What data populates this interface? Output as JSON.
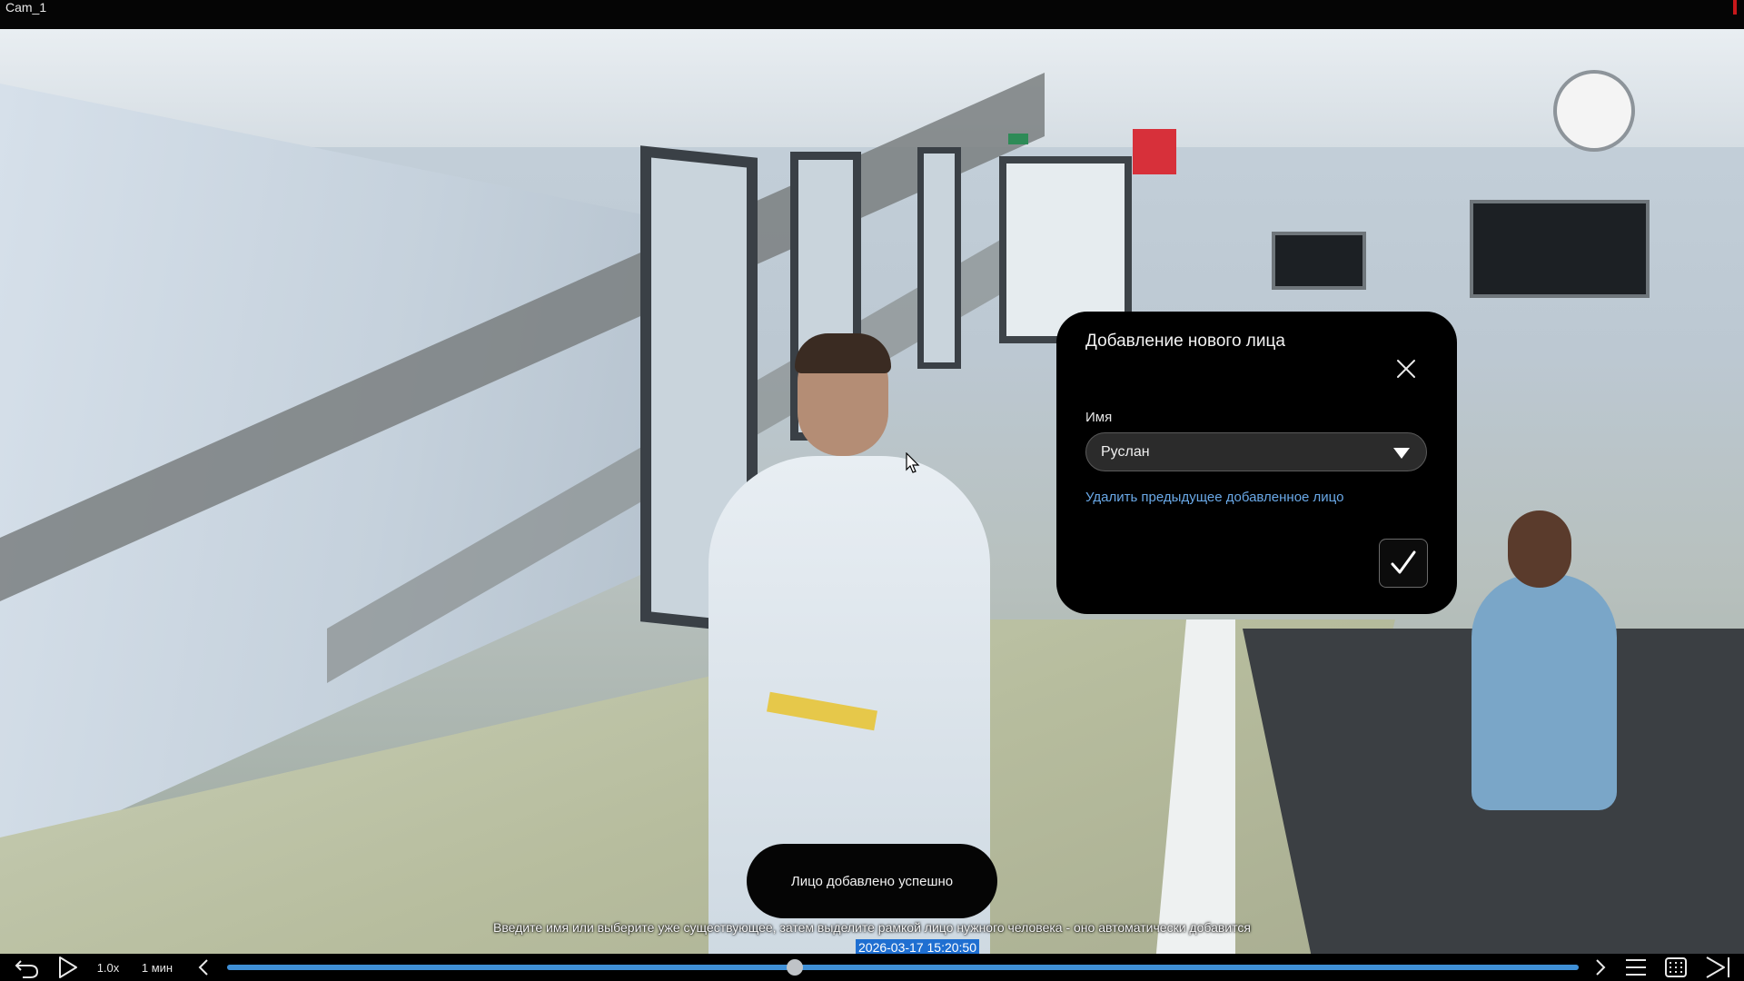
{
  "window": {
    "title": "Cam_1"
  },
  "dialog": {
    "title": "Добавление нового лица",
    "name_label": "Имя",
    "name_value": "Руслан",
    "delete_link": "Удалить предыдущее добавленное лицо"
  },
  "toast": {
    "text": "Лицо добавлено успешно"
  },
  "hint": {
    "text": "Введите имя или выберите уже существующее, затем выделите рамкой лицо нужного человека - оно автоматически добавится"
  },
  "playback": {
    "timestamp": "2026-03-17 15:20:50",
    "speed": "1.0x",
    "interval": "1 мин",
    "position_fraction": 0.42
  },
  "icons": {
    "close": "close-icon",
    "dropdown": "chevron-down-icon",
    "confirm": "check-icon",
    "back": "undo-arrow-icon",
    "play": "play-icon",
    "prev": "chevron-left-icon",
    "next": "chevron-right-icon",
    "menu": "menu-icon",
    "grid": "grid-icon",
    "skip_end": "skip-to-end-icon"
  },
  "colors": {
    "link": "#6aa9e8",
    "timestamp_bg": "#1f6fd1",
    "timeline": "#3f8fd6",
    "recording": "#c8181b"
  }
}
